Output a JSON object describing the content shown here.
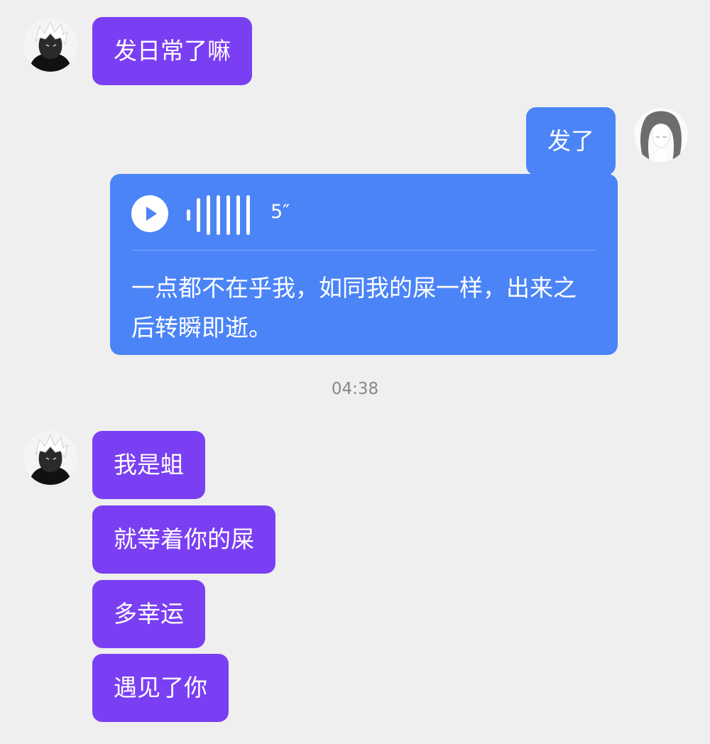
{
  "colors": {
    "background": "#efefef",
    "incoming_bubble": "#7a3ff2",
    "outgoing_bubble": "#4b84f7",
    "timestamp_text": "#888888"
  },
  "avatars": {
    "contact": "contact-avatar-icon",
    "self": "self-avatar-icon"
  },
  "messages": {
    "m1": "发日常了嘛",
    "m2": "发了",
    "voice": {
      "icon": "play-icon",
      "duration": "5″",
      "transcript": "一点都不在乎我，如同我的屎一样，出来之后转瞬即逝。"
    },
    "timestamp": "04:38",
    "m3": "我是蛆",
    "m4": "就等着你的屎",
    "m5": "多幸运",
    "m6": "遇见了你"
  }
}
